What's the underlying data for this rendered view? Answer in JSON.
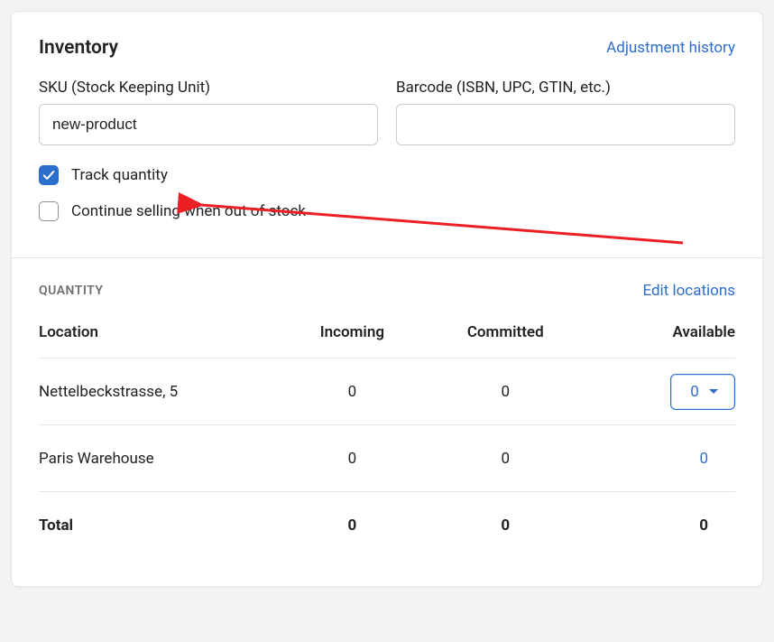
{
  "header": {
    "title": "Inventory",
    "history_link": "Adjustment history"
  },
  "fields": {
    "sku_label": "SKU (Stock Keeping Unit)",
    "sku_value": "new-product",
    "barcode_label": "Barcode (ISBN, UPC, GTIN, etc.)",
    "barcode_value": ""
  },
  "options": {
    "track_label": "Track quantity",
    "track_checked": true,
    "continue_label": "Continue selling when out of stock",
    "continue_checked": false
  },
  "quantity_section": {
    "title": "QUANTITY",
    "edit_link": "Edit locations",
    "columns": {
      "location": "Location",
      "incoming": "Incoming",
      "committed": "Committed",
      "available": "Available"
    },
    "rows": [
      {
        "location": "Nettelbeckstrasse, 5",
        "incoming": "0",
        "committed": "0",
        "available": "0",
        "available_mode": "picker"
      },
      {
        "location": "Paris Warehouse",
        "incoming": "0",
        "committed": "0",
        "available": "0",
        "available_mode": "link"
      }
    ],
    "total_label": "Total",
    "total": {
      "incoming": "0",
      "committed": "0",
      "available": "0"
    }
  }
}
